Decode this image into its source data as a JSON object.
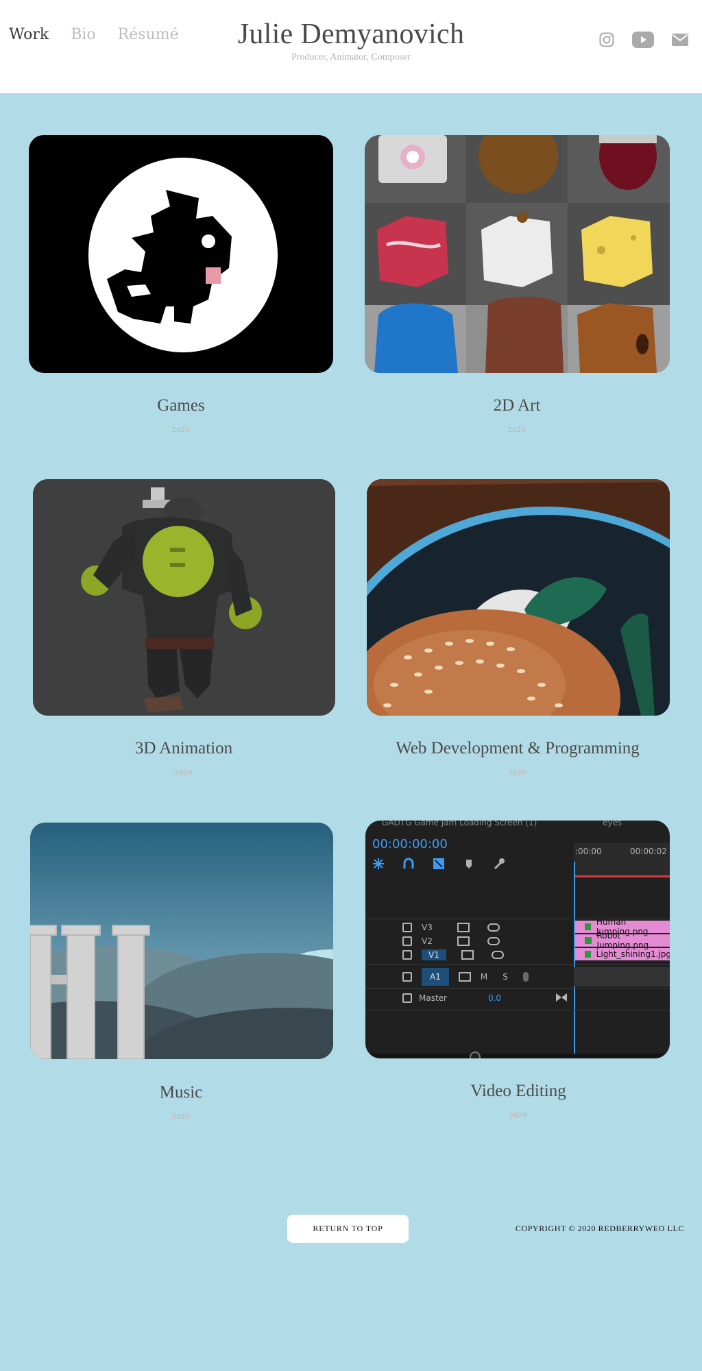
{
  "header": {
    "nav": [
      "Work",
      "Bio",
      "Résumé"
    ],
    "name": "Julie Demyanovich",
    "tagline": "Producer, Animator, Composer",
    "social_icons": [
      "instagram-icon",
      "youtube-icon",
      "email-icon"
    ]
  },
  "projects": [
    {
      "title": "Games",
      "year": "2020"
    },
    {
      "title": "2D Art",
      "year": "2020"
    },
    {
      "title": "3D Animation",
      "year": "2020"
    },
    {
      "title": "Web Development & Programming",
      "year": "2020"
    },
    {
      "title": "Music",
      "year": "2020"
    },
    {
      "title": "Video Editing",
      "year": "2020"
    }
  ],
  "editor": {
    "panel_title": "GADTG Game Jam Loading Screen (1)",
    "panel_title2": "eyes",
    "timecode": "00:00:00:00",
    "ruler_start": ":00:00",
    "ruler_next": "00:00:02",
    "tracks_video": [
      "V3",
      "V2",
      "V1"
    ],
    "track_audio": "A1",
    "audio_m": "M",
    "audio_s": "S",
    "master_label": "Master",
    "master_value": "0.0",
    "clips": [
      "Human Jumping.png",
      "Robot Jumping.png",
      "Light_shining1.jpg"
    ]
  },
  "footer": {
    "return_label": "RETURN TO TOP",
    "copyright": "COPYRIGHT © 2020 REDBERRYWEO LLC"
  },
  "colors": {
    "background": "#b2dbe8",
    "header": "#ffffff",
    "year": "#c9a8a2",
    "text": "#4a4a4a"
  }
}
